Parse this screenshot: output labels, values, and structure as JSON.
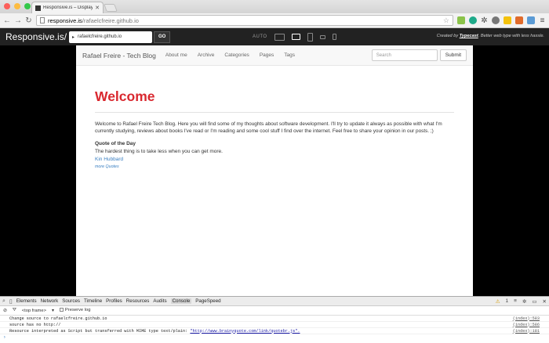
{
  "browser": {
    "tab_title": "Responsive.is – Display w…",
    "url_host": "responsive.is",
    "url_path": "/rafaelcfreire.github.io"
  },
  "responsive": {
    "logo": "Responsive.is/",
    "url_value": "rafaelcfreire.github.io",
    "go_label": "GO",
    "auto_label": "AUTO",
    "credit_prefix": "Created by ",
    "credit_brand": "Typecast",
    "credit_suffix": ". Better web type with less hassle."
  },
  "site": {
    "brand": "Rafael Freire - Tech Blog",
    "nav": [
      "About me",
      "Archive",
      "Categories",
      "Pages",
      "Tags"
    ],
    "search_placeholder": "Search",
    "submit_label": "Submit",
    "heading": "Welcome",
    "intro": "Welcome to Rafael Freire Tech Blog. Here you will find some of my thoughts about software development. I'll try to update it always as possible with what I'm currently studying, reviews about books I've read or I'm reading and some cool stuff I find over the internet. Feel free to share your opinion in our posts. ;)",
    "quote_title": "Quote of the Day",
    "quote": "The hardest thing is to take less when you can get more.",
    "author": "Kin Hubbard",
    "more": "more Quotes"
  },
  "devtools": {
    "tabs": [
      "Elements",
      "Network",
      "Sources",
      "Timeline",
      "Profiles",
      "Resources",
      "Audits",
      "Console",
      "PageSpeed"
    ],
    "active_tab": "Console",
    "warning_count": "1",
    "frame": "<top frame>",
    "preserve_log": "Preserve log",
    "rows": [
      {
        "text": "Change source to rafaelcfreire.github.io",
        "link": "",
        "loc": "(index):583"
      },
      {
        "text": "source has no http://",
        "link": "",
        "loc": "(index):586"
      },
      {
        "text": "Resource interpreted as Script but transferred with MIME type text/plain: ",
        "link": "\"http://www.brainyquote.com/link/quotebr.js\".",
        "loc": "(index):181"
      }
    ]
  },
  "colors": {
    "heading": "#d9282f",
    "link": "#3a7fc1",
    "topbar": "#222222"
  }
}
